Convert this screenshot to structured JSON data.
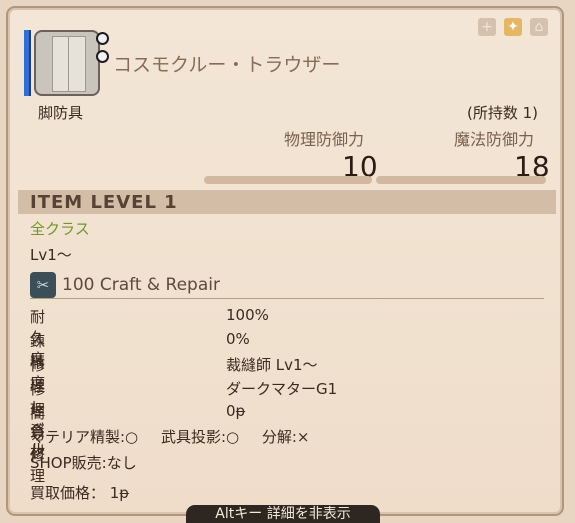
{
  "item": {
    "name": "コスモクルー・トラウザー",
    "slot": "脚防具",
    "owned": "(所持数 1)",
    "physical_label": "物理防御力",
    "physical_value": "10",
    "magic_label": "魔法防御力",
    "magic_value": "18",
    "item_level": "ITEM LEVEL  1",
    "classes": "全クラス",
    "level": "Lv1～",
    "craft": "100 Craft & Repair"
  },
  "repair": [
    {
      "label": "耐久度",
      "value": "100%"
    },
    {
      "label": "錬精度",
      "value": "0%"
    },
    {
      "label": "修理レベル",
      "value": "裁縫師 Lv1～"
    },
    {
      "label": "修理資材",
      "value": "ダークマターG1"
    },
    {
      "label": "簡易修理",
      "value": "0ᵽ"
    }
  ],
  "flags": {
    "materia": "マテリア精製:○",
    "glamour": "武具投影:○",
    "desynth": "分解:×"
  },
  "shop": "SHOP販売:なし",
  "price": "買取価格： 1ᵽ",
  "footer": "Altキー 詳細を非表示",
  "icons": [
    "plus-icon",
    "sell-icon",
    "hq-icon"
  ]
}
